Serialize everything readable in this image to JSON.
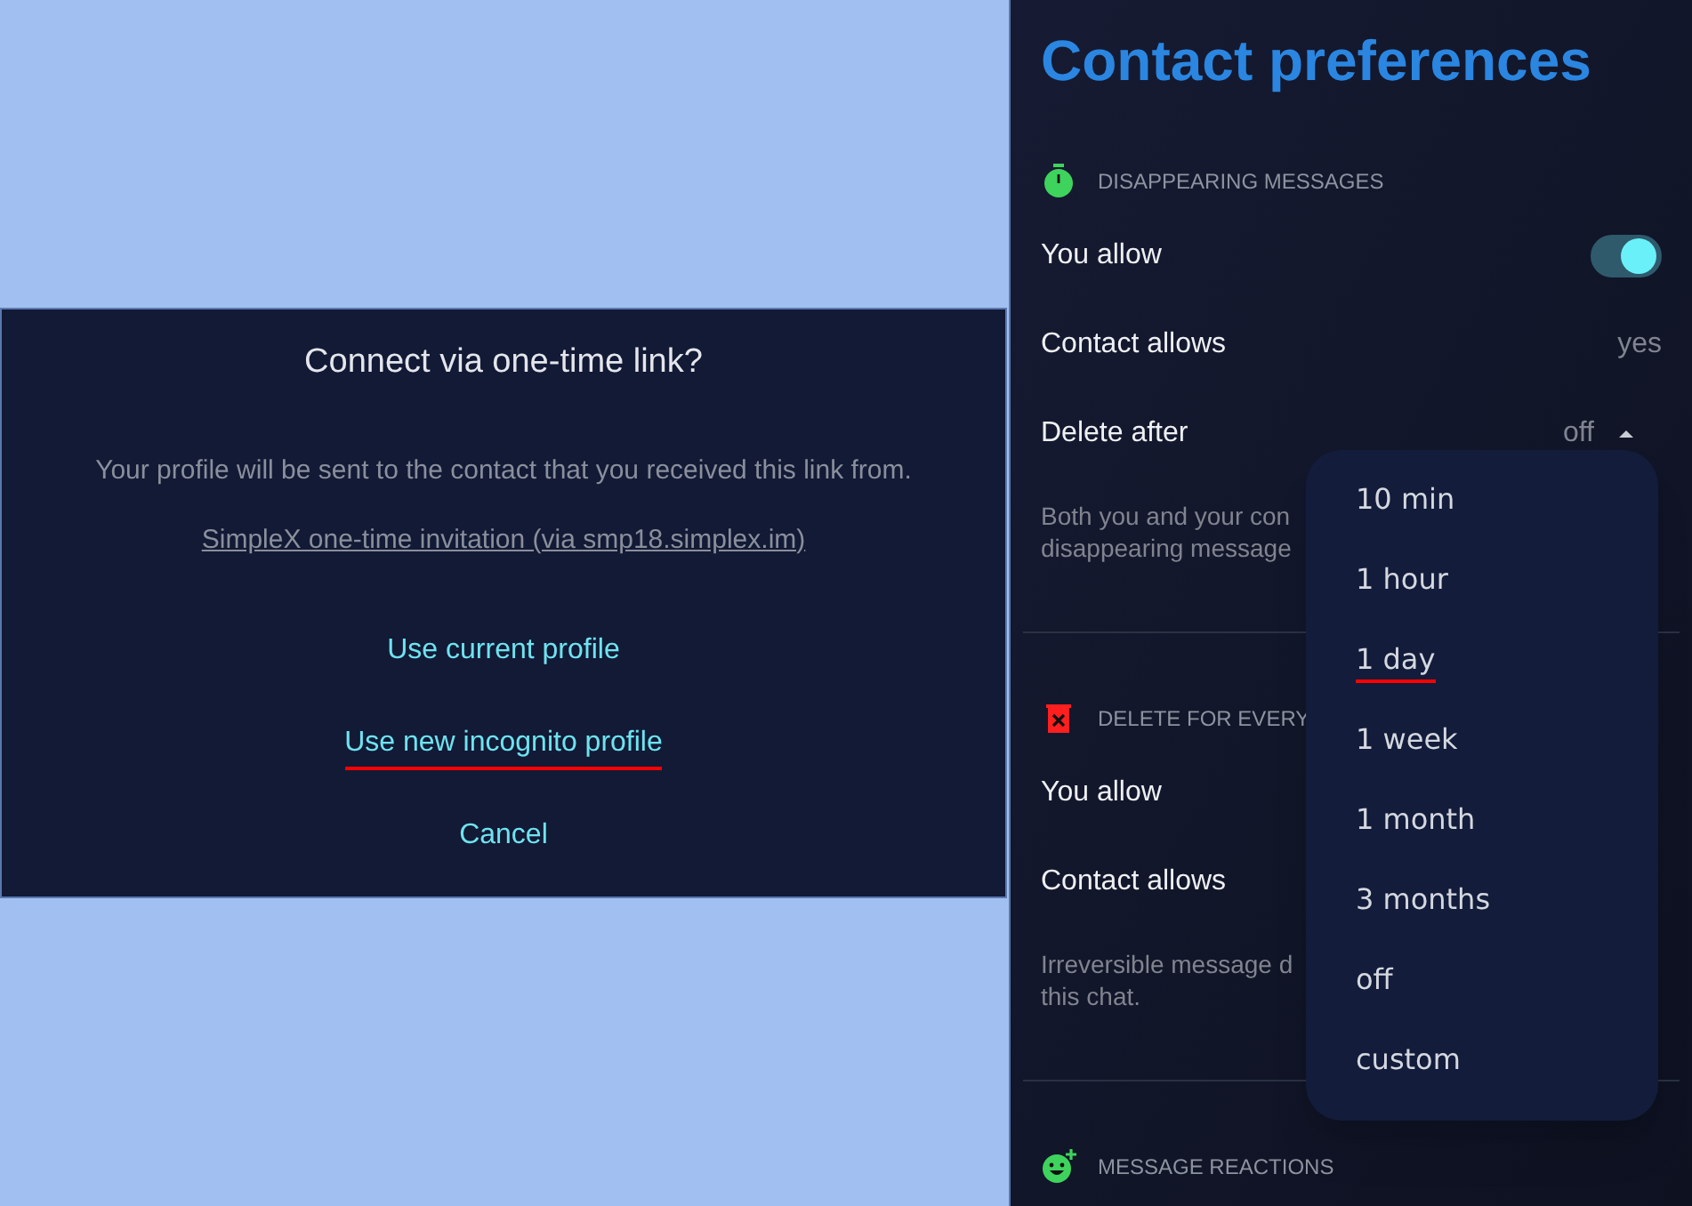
{
  "dialog": {
    "title": "Connect via one-time link?",
    "message": "Your profile will be sent to the contact that you received this link from.",
    "link": "SimpleX one-time invitation (via smp18.simplex.im)",
    "actions": [
      {
        "label": "Use current profile",
        "underlined": false
      },
      {
        "label": "Use new incognito profile",
        "underlined": true
      },
      {
        "label": "Cancel",
        "underlined": false
      }
    ]
  },
  "preferences": {
    "title": "Contact preferences",
    "sections": [
      {
        "header": "DISAPPEARING MESSAGES",
        "rows": [
          {
            "kind": "toggle",
            "label": "You allow",
            "on": true
          },
          {
            "kind": "value",
            "label": "Contact allows",
            "value": "yes"
          },
          {
            "kind": "select",
            "label": "Delete after",
            "value": "off",
            "expanded": true
          }
        ],
        "description": [
          "Both you and your con",
          "disappearing message"
        ]
      },
      {
        "header": "DELETE FOR EVERY",
        "rows": [
          {
            "kind": "label",
            "label": "You allow"
          },
          {
            "kind": "label",
            "label": "Contact allows"
          }
        ],
        "description": [
          "Irreversible message d",
          "this chat."
        ]
      },
      {
        "header": "MESSAGE REACTIONS"
      }
    ],
    "menu": [
      {
        "label": "10 min",
        "underlined": false
      },
      {
        "label": "1 hour",
        "underlined": false
      },
      {
        "label": "1 day",
        "underlined": true
      },
      {
        "label": "1 week",
        "underlined": false
      },
      {
        "label": "1 month",
        "underlined": false
      },
      {
        "label": "3 months",
        "underlined": false
      },
      {
        "label": "off",
        "underlined": false
      },
      {
        "label": "custom",
        "underlined": false
      }
    ]
  }
}
